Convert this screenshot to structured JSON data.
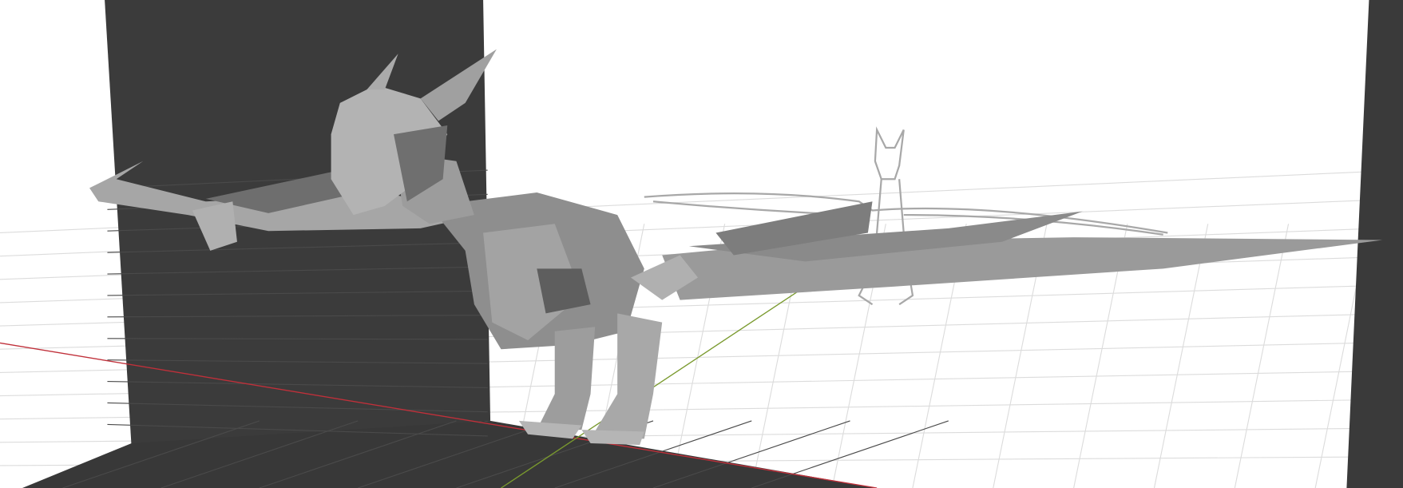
{
  "viewport": {
    "name": "3d-viewport",
    "colors": {
      "background": "#ffffff",
      "backdrop_panel": "#3b3b3b",
      "floor_dark": "#383838",
      "grid_light": "#d9d9d9",
      "grid_dark": "#4a4a4a",
      "x_axis": "#c0303a",
      "y_axis": "#7a9a2e",
      "model_light": "#b8b8b8",
      "model_mid": "#8e8e8e",
      "model_dark": "#5e5e5e",
      "reference_sketch": "#a8a8a8"
    }
  }
}
